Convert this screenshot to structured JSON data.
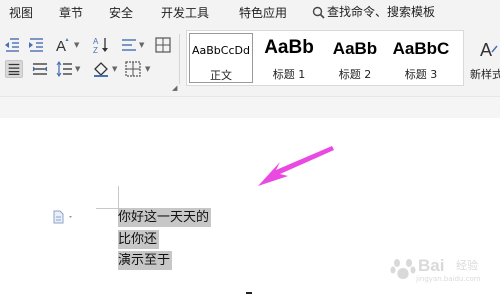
{
  "menu": {
    "tabs": [
      "视图",
      "章节",
      "安全",
      "开发工具",
      "特色应用"
    ],
    "search_label": "查找命令、搜索模板"
  },
  "icons": {
    "decrease_indent": "decrease-indent-icon",
    "increase_indent": "increase-indent-icon",
    "font_style": "font-style-icon",
    "sort": "sort-icon",
    "line_spacing": "line-spacing-icon",
    "border": "border-icon",
    "align_left": "align-left-icon",
    "distributed": "distributed-align-icon",
    "paragraph_spacing": "paragraph-spacing-icon",
    "fill": "fill-color-icon",
    "table_border": "table-border-icon",
    "new_style": "new-style-icon",
    "search": "search-icon",
    "paragraph_marker": "paragraph-marker-icon",
    "annotation_arrow": "annotation-arrow"
  },
  "styles": [
    {
      "preview": "AaBbCcDd",
      "label": "正文"
    },
    {
      "preview": "AaBb",
      "label": "标题 1"
    },
    {
      "preview": "AaBb",
      "label": "标题 2"
    },
    {
      "preview": "AaBbC",
      "label": "标题 3"
    }
  ],
  "new_style_label": "新样式",
  "document": {
    "lines": [
      "你好这一天天的",
      "比你还",
      "演示至于"
    ]
  },
  "watermark": {
    "brand": "Bai",
    "sub": "经验",
    "url": "jingyan.baidu.com"
  },
  "colors": {
    "accent": "#e83ae0",
    "selection": "#c7c7c7",
    "ribbon_bg": "#f3f3f3"
  }
}
